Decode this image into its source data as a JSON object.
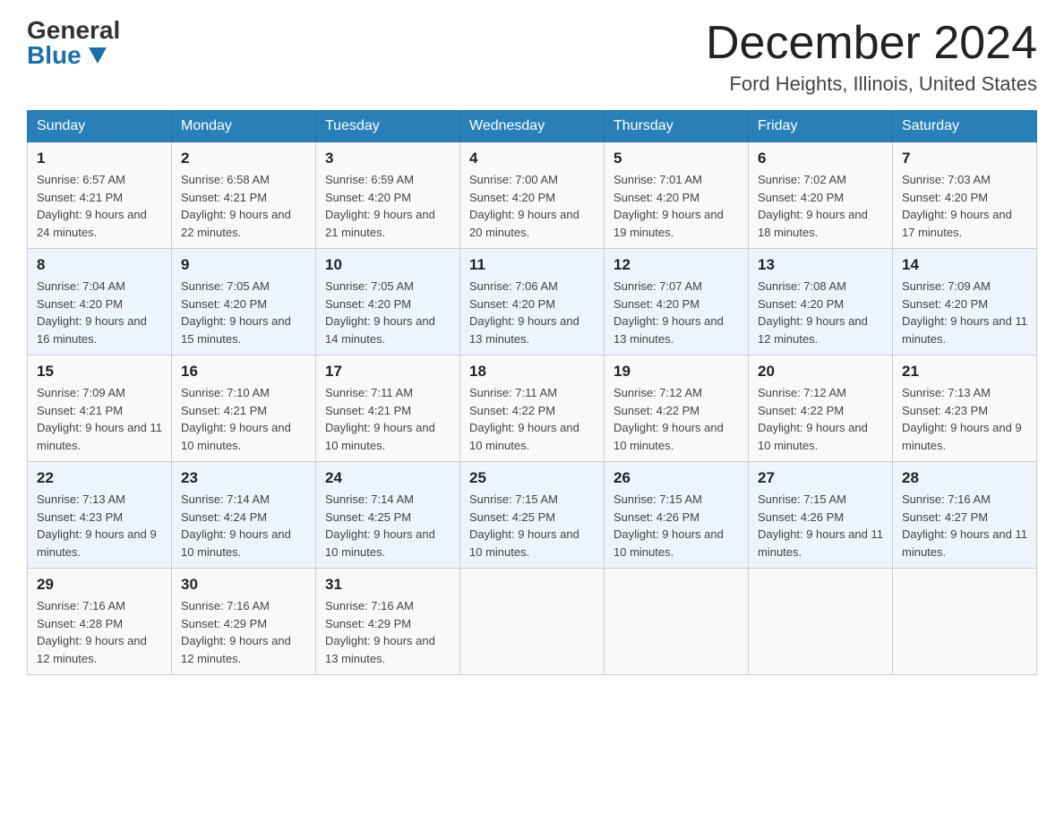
{
  "header": {
    "logo_general": "General",
    "logo_blue": "Blue",
    "month_title": "December 2024",
    "location": "Ford Heights, Illinois, United States"
  },
  "weekdays": [
    "Sunday",
    "Monday",
    "Tuesday",
    "Wednesday",
    "Thursday",
    "Friday",
    "Saturday"
  ],
  "weeks": [
    [
      {
        "day": "1",
        "sunrise": "6:57 AM",
        "sunset": "4:21 PM",
        "daylight": "9 hours and 24 minutes."
      },
      {
        "day": "2",
        "sunrise": "6:58 AM",
        "sunset": "4:21 PM",
        "daylight": "9 hours and 22 minutes."
      },
      {
        "day": "3",
        "sunrise": "6:59 AM",
        "sunset": "4:20 PM",
        "daylight": "9 hours and 21 minutes."
      },
      {
        "day": "4",
        "sunrise": "7:00 AM",
        "sunset": "4:20 PM",
        "daylight": "9 hours and 20 minutes."
      },
      {
        "day": "5",
        "sunrise": "7:01 AM",
        "sunset": "4:20 PM",
        "daylight": "9 hours and 19 minutes."
      },
      {
        "day": "6",
        "sunrise": "7:02 AM",
        "sunset": "4:20 PM",
        "daylight": "9 hours and 18 minutes."
      },
      {
        "day": "7",
        "sunrise": "7:03 AM",
        "sunset": "4:20 PM",
        "daylight": "9 hours and 17 minutes."
      }
    ],
    [
      {
        "day": "8",
        "sunrise": "7:04 AM",
        "sunset": "4:20 PM",
        "daylight": "9 hours and 16 minutes."
      },
      {
        "day": "9",
        "sunrise": "7:05 AM",
        "sunset": "4:20 PM",
        "daylight": "9 hours and 15 minutes."
      },
      {
        "day": "10",
        "sunrise": "7:05 AM",
        "sunset": "4:20 PM",
        "daylight": "9 hours and 14 minutes."
      },
      {
        "day": "11",
        "sunrise": "7:06 AM",
        "sunset": "4:20 PM",
        "daylight": "9 hours and 13 minutes."
      },
      {
        "day": "12",
        "sunrise": "7:07 AM",
        "sunset": "4:20 PM",
        "daylight": "9 hours and 13 minutes."
      },
      {
        "day": "13",
        "sunrise": "7:08 AM",
        "sunset": "4:20 PM",
        "daylight": "9 hours and 12 minutes."
      },
      {
        "day": "14",
        "sunrise": "7:09 AM",
        "sunset": "4:20 PM",
        "daylight": "9 hours and 11 minutes."
      }
    ],
    [
      {
        "day": "15",
        "sunrise": "7:09 AM",
        "sunset": "4:21 PM",
        "daylight": "9 hours and 11 minutes."
      },
      {
        "day": "16",
        "sunrise": "7:10 AM",
        "sunset": "4:21 PM",
        "daylight": "9 hours and 10 minutes."
      },
      {
        "day": "17",
        "sunrise": "7:11 AM",
        "sunset": "4:21 PM",
        "daylight": "9 hours and 10 minutes."
      },
      {
        "day": "18",
        "sunrise": "7:11 AM",
        "sunset": "4:22 PM",
        "daylight": "9 hours and 10 minutes."
      },
      {
        "day": "19",
        "sunrise": "7:12 AM",
        "sunset": "4:22 PM",
        "daylight": "9 hours and 10 minutes."
      },
      {
        "day": "20",
        "sunrise": "7:12 AM",
        "sunset": "4:22 PM",
        "daylight": "9 hours and 10 minutes."
      },
      {
        "day": "21",
        "sunrise": "7:13 AM",
        "sunset": "4:23 PM",
        "daylight": "9 hours and 9 minutes."
      }
    ],
    [
      {
        "day": "22",
        "sunrise": "7:13 AM",
        "sunset": "4:23 PM",
        "daylight": "9 hours and 9 minutes."
      },
      {
        "day": "23",
        "sunrise": "7:14 AM",
        "sunset": "4:24 PM",
        "daylight": "9 hours and 10 minutes."
      },
      {
        "day": "24",
        "sunrise": "7:14 AM",
        "sunset": "4:25 PM",
        "daylight": "9 hours and 10 minutes."
      },
      {
        "day": "25",
        "sunrise": "7:15 AM",
        "sunset": "4:25 PM",
        "daylight": "9 hours and 10 minutes."
      },
      {
        "day": "26",
        "sunrise": "7:15 AM",
        "sunset": "4:26 PM",
        "daylight": "9 hours and 10 minutes."
      },
      {
        "day": "27",
        "sunrise": "7:15 AM",
        "sunset": "4:26 PM",
        "daylight": "9 hours and 11 minutes."
      },
      {
        "day": "28",
        "sunrise": "7:16 AM",
        "sunset": "4:27 PM",
        "daylight": "9 hours and 11 minutes."
      }
    ],
    [
      {
        "day": "29",
        "sunrise": "7:16 AM",
        "sunset": "4:28 PM",
        "daylight": "9 hours and 12 minutes."
      },
      {
        "day": "30",
        "sunrise": "7:16 AM",
        "sunset": "4:29 PM",
        "daylight": "9 hours and 12 minutes."
      },
      {
        "day": "31",
        "sunrise": "7:16 AM",
        "sunset": "4:29 PM",
        "daylight": "9 hours and 13 minutes."
      },
      null,
      null,
      null,
      null
    ]
  ]
}
